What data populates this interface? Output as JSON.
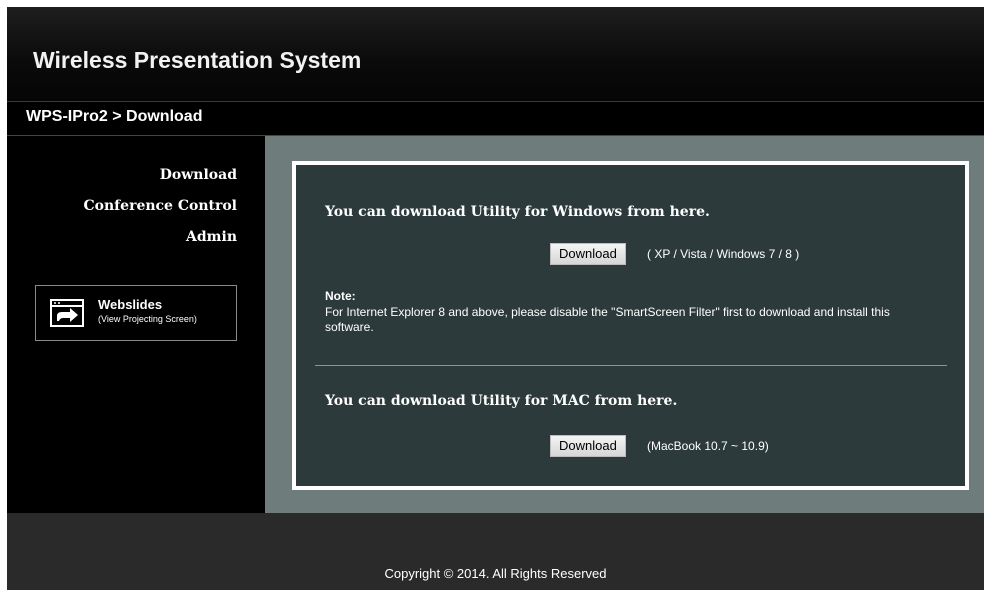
{
  "header": {
    "app_title": "Wireless Presentation System"
  },
  "breadcrumb": "WPS-IPro2 > Download",
  "sidebar": {
    "items": [
      {
        "label": "Download"
      },
      {
        "label": "Conference Control"
      },
      {
        "label": "Admin"
      }
    ],
    "webslides": {
      "title": "Webslides",
      "subtitle": "(View Projecting Screen)",
      "icon": "projector-screen-icon"
    }
  },
  "main": {
    "windows_heading": "You can download Utility for Windows from here.",
    "windows_button": "Download",
    "windows_note": "( XP / Vista / Windows 7 / 8 )",
    "note_label": "Note:",
    "note_text": "For Internet Explorer 8 and above, please disable the \"SmartScreen Filter\" first to download and install this software.",
    "mac_heading": "You can download Utility for MAC from here.",
    "mac_button": "Download",
    "mac_note": "(MacBook 10.7 ~ 10.9)"
  },
  "footer": {
    "copyright": "Copyright © 2014. All Rights Reserved"
  },
  "colors": {
    "main_bg": "#6e7d7c",
    "panel_bg": "#2d3a3b",
    "footer_bg": "#2a2a2a"
  }
}
